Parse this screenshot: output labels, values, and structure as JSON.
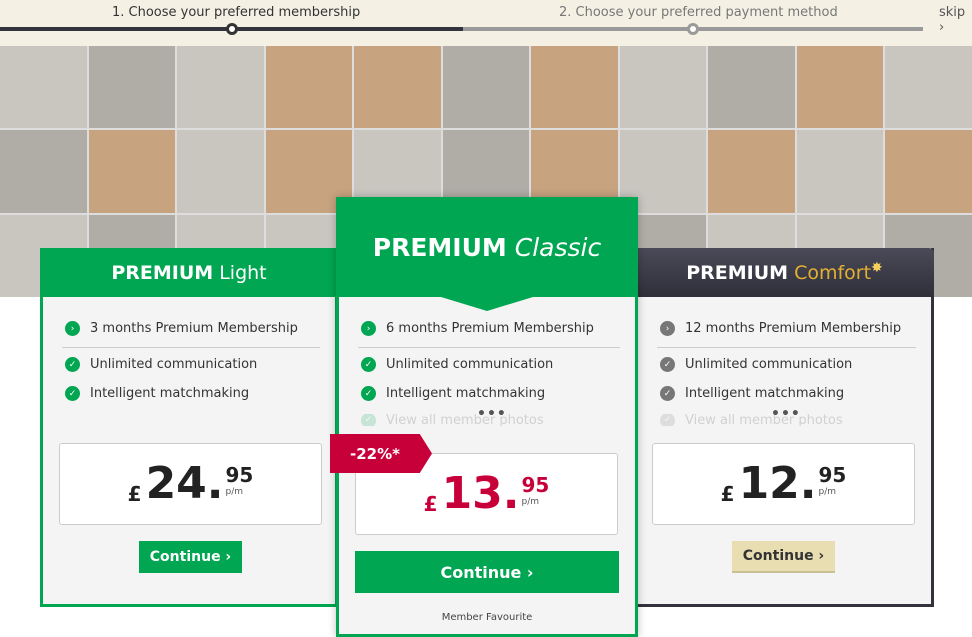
{
  "progress": {
    "step1": "1. Choose your preferred membership",
    "step2": "2. Choose your preferred payment method",
    "skip": "skip ›"
  },
  "colors": {
    "green": "#00a651",
    "red": "#c8003a",
    "dark": "#3a3a48",
    "gold": "#e5b032",
    "comfort_button": "#e8deb2"
  },
  "plans": [
    {
      "title": "PREMIUM",
      "subtitle": "Light",
      "features": [
        "3 months Premium Membership",
        "Unlimited communication",
        "Intelligent matchmaking"
      ],
      "currency": "£",
      "price_whole": "24.",
      "price_cents": "95",
      "per": "p/m",
      "button": "Continue ›"
    },
    {
      "title": "PREMIUM",
      "subtitle": "Classic",
      "features": [
        "6 months Premium Membership",
        "Unlimited communication",
        "Intelligent matchmaking",
        "View all member photos"
      ],
      "more": "•••",
      "badge": "-22%*",
      "currency": "£",
      "price_whole": "13.",
      "price_cents": "95",
      "per": "p/m",
      "button": "Continue ›",
      "footer": "Member Favourite"
    },
    {
      "title": "PREMIUM",
      "subtitle": "Comfort",
      "features": [
        "12 months Premium Membership",
        "Unlimited communication",
        "Intelligent matchmaking",
        "View all member photos"
      ],
      "more": "•••",
      "currency": "£",
      "price_whole": "12.",
      "price_cents": "95",
      "per": "p/m",
      "button": "Continue ›"
    }
  ]
}
